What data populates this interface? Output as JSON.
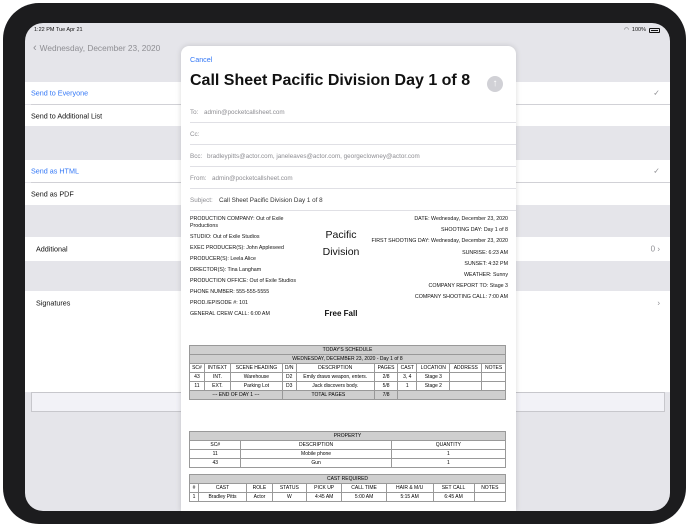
{
  "status_bar": {
    "time": "1:22 PM  Tue Apr 21",
    "battery": "100%"
  },
  "nav": {
    "back_label": "Wednesday, December 23, 2020"
  },
  "list": {
    "send_to_everyone": "Send to Everyone",
    "send_to_additional": "Send to Additional List",
    "send_as_html": "Send as HTML",
    "send_as_pdf": "Send as PDF",
    "additional": "Additional",
    "additional_count": "0",
    "signatures": "Signatures",
    "checkmark": "✓",
    "chevron": "›"
  },
  "compose": {
    "cancel": "Cancel",
    "subject_title": "Call Sheet Pacific Division Day 1 of 8",
    "send_icon": "arrow-up-icon",
    "to": {
      "label": "To:",
      "value": "admin@pocketcallsheet.com"
    },
    "cc": {
      "label": "Cc:",
      "value": ""
    },
    "bcc": {
      "label": "Bcc:",
      "value": "bradleypitts@actor.com, janeleaves@actor.com, georgeclowney@actor.com"
    },
    "from": {
      "label": "From:",
      "value": "admin@pocketcallsheet.com"
    },
    "subject": {
      "label": "Subject:",
      "value": "Call Sheet Pacific Division Day 1 of 8"
    }
  },
  "call_sheet": {
    "left": [
      "PRODUCTION COMPANY: Out of Exile Productions",
      "STUDIO: Out of Exile Studios",
      "EXEC PRODUCER(S): John Appleseed",
      "PRODUCER(S): Leela Alice",
      "DIRECTOR(S): Tina Langham",
      "PRODUCTION OFFICE: Out of Exile Studios",
      "PHONE NUMBER: 555-555-5555",
      "PROD./EPISODE #: 101",
      "GENERAL CREW CALL: 6:00 AM"
    ],
    "center_title_1": "Pacific",
    "center_title_2": "Division",
    "center_subtitle": "Free Fall",
    "right": [
      "DATE: Wednesday, December 23, 2020",
      "SHOOTING DAY: Day 1 of 8",
      "FIRST SHOOTING DAY: Wednesday, December 23, 2020",
      "SUNRISE: 6:23 AM",
      "SUNSET: 4:32 PM",
      "WEATHER: Sunny",
      "COMPANY REPORT TO: Stage 3",
      "COMPANY SHOOTING CALL: 7:00 AM"
    ],
    "schedule": {
      "title": "TODAY'S SCHEDULE",
      "subtitle": "WEDNESDAY, DECEMBER 23, 2020 - Day 1 of 8",
      "headers": [
        "SC#",
        "INT/EXT",
        "SCENE HEADING",
        "D/N",
        "DESCRIPTION",
        "PAGES",
        "CAST",
        "LOCATION",
        "ADDRESS",
        "NOTES"
      ],
      "rows": [
        [
          "43",
          "INT.",
          "Warehouse",
          "D2",
          "Emily draws weapon, enters.",
          "2/8",
          "3, 4",
          "Stage 3",
          "",
          ""
        ],
        [
          "11",
          "EXT.",
          "Parking Lot",
          "D3",
          "Jack discovers body.",
          "5/8",
          "1",
          "Stage 2",
          "",
          ""
        ]
      ],
      "end_label": "--- END OF DAY 1 ---",
      "total_label": "TOTAL PAGES",
      "total_value": "7/8"
    },
    "property": {
      "title": "PROPERTY",
      "headers": [
        "SC#",
        "DESCRIPTION",
        "QUANTITY"
      ],
      "rows": [
        [
          "11",
          "Mobile phone",
          "1"
        ],
        [
          "43",
          "Gun",
          "1"
        ]
      ]
    },
    "cast": {
      "title": "CAST REQUIRED",
      "headers": [
        "#",
        "CAST",
        "ROLE",
        "STATUS",
        "PICK UP",
        "CALL TIME",
        "HAIR & M/U",
        "SET CALL",
        "NOTES"
      ],
      "rows": [
        [
          "1",
          "Bradley Pitts",
          "Actor",
          "W",
          "4:45 AM",
          "5:00 AM",
          "5:15 AM",
          "6:45 AM",
          ""
        ]
      ]
    }
  },
  "colors": {
    "accent": "#3478f6",
    "device": "#1c1c1e",
    "background": "#e5e5ea"
  }
}
